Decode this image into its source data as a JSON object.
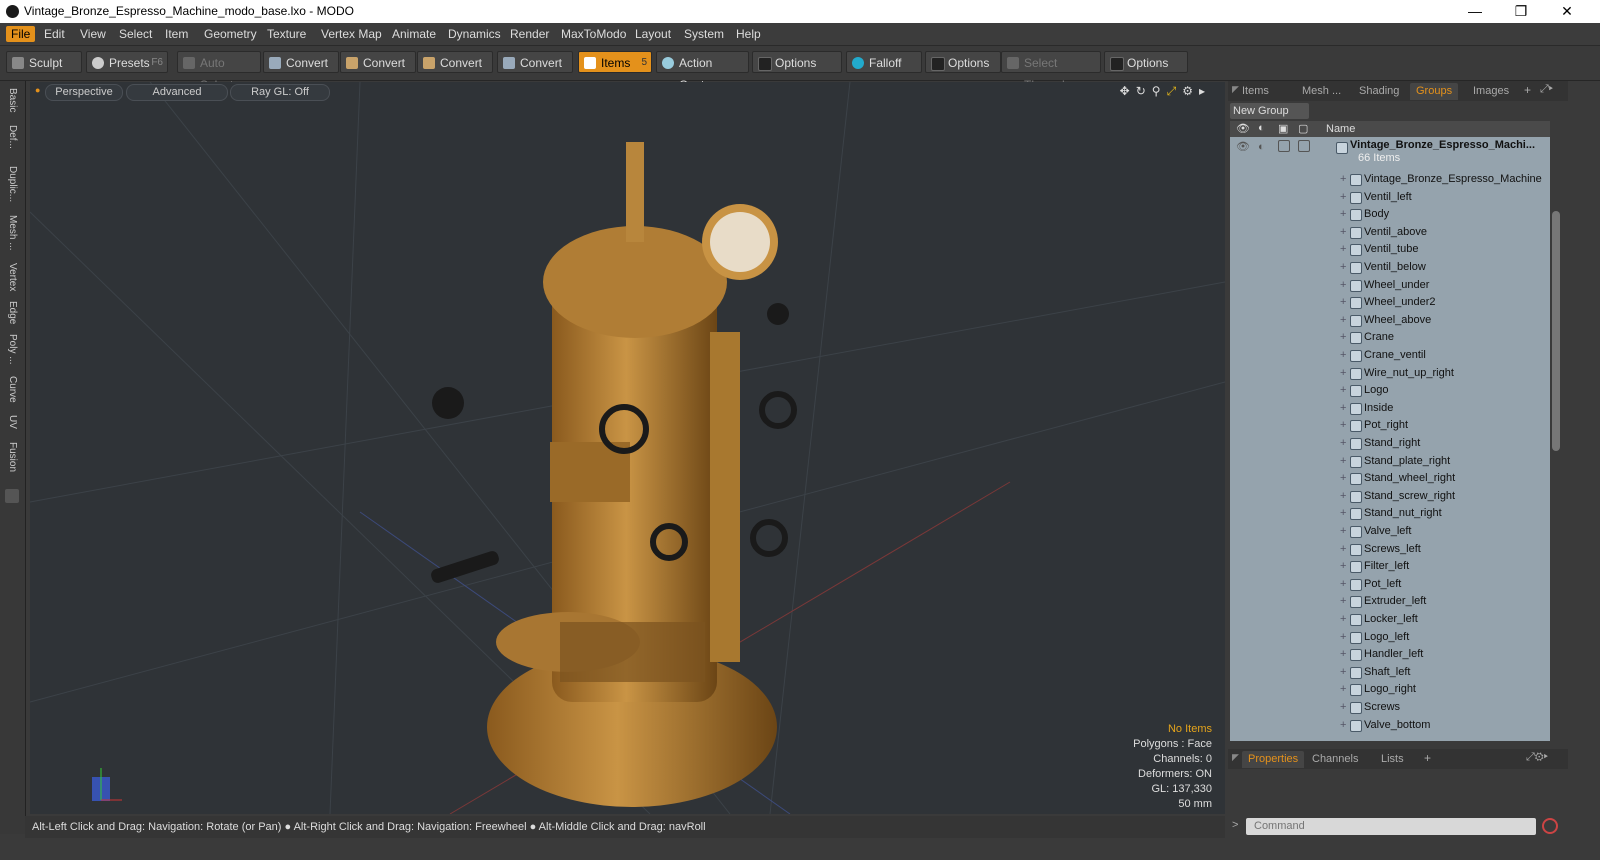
{
  "window": {
    "title": "Vintage_Bronze_Espresso_Machine_modo_base.lxo - MODO",
    "minimize": "—",
    "maximize": "❐",
    "close": "✕"
  },
  "menu": [
    "File",
    "Edit",
    "View",
    "Select",
    "Item",
    "Geometry",
    "Texture",
    "Vertex Map",
    "Animate",
    "Dynamics",
    "Render",
    "MaxToModo",
    "Layout",
    "System",
    "Help"
  ],
  "toolbar": {
    "sculpt": "Sculpt",
    "presets": "Presets",
    "presets_key": "F6",
    "auto_select": "Auto Select",
    "convert1": "Convert",
    "convert2": "Convert",
    "convert3": "Convert",
    "convert4": "Convert",
    "items": "Items",
    "items_key": "5",
    "action_center": "Action Center",
    "options1": "Options",
    "falloff": "Falloff",
    "options2": "Options",
    "select_through": "Select Through",
    "options3": "Options"
  },
  "left_tabs": [
    "Basic",
    "Def...",
    "Duplic...",
    "Mesh ...",
    "Vertex",
    "Edge",
    "Poly ...",
    "Curve",
    "UV",
    "Fusion"
  ],
  "viewport": {
    "perspective": "Perspective",
    "advanced": "Advanced",
    "ray_gl": "Ray GL: Off",
    "info": {
      "no_items": "No Items",
      "polygons": "Polygons : Face",
      "channels": "Channels: 0",
      "deformers": "Deformers: ON",
      "gl": "GL: 137,330",
      "scale": "50 mm"
    }
  },
  "status": "Alt-Left Click and Drag: Navigation: Rotate (or Pan) ● Alt-Right Click and Drag: Navigation: Freewheel ● Alt-Middle Click and Drag: navRoll",
  "right_tabs": [
    "Items",
    "Mesh ...",
    "Shading",
    "Groups",
    "Images"
  ],
  "new_group": "New Group",
  "list_header": "Name",
  "group": {
    "name": "Vintage_Bronze_Espresso_Machi...",
    "count": "66 Items"
  },
  "items": [
    "Vintage_Bronze_Espresso_Machine",
    "Ventil_left",
    "Body",
    "Ventil_above",
    "Ventil_tube",
    "Ventil_below",
    "Wheel_under",
    "Wheel_under2",
    "Wheel_above",
    "Crane",
    "Crane_ventil",
    "Wire_nut_up_right",
    "Logo",
    "Inside",
    "Pot_right",
    "Stand_right",
    "Stand_plate_right",
    "Stand_wheel_right",
    "Stand_screw_right",
    "Stand_nut_right",
    "Valve_left",
    "Screws_left",
    "Filter_left",
    "Pot_left",
    "Extruder_left",
    "Locker_left",
    "Logo_left",
    "Handler_left",
    "Shaft_left",
    "Logo_right",
    "Screws",
    "Valve_bottom"
  ],
  "bottom_tabs": [
    "Properties",
    "Channels",
    "Lists"
  ],
  "command_placeholder": "Command"
}
